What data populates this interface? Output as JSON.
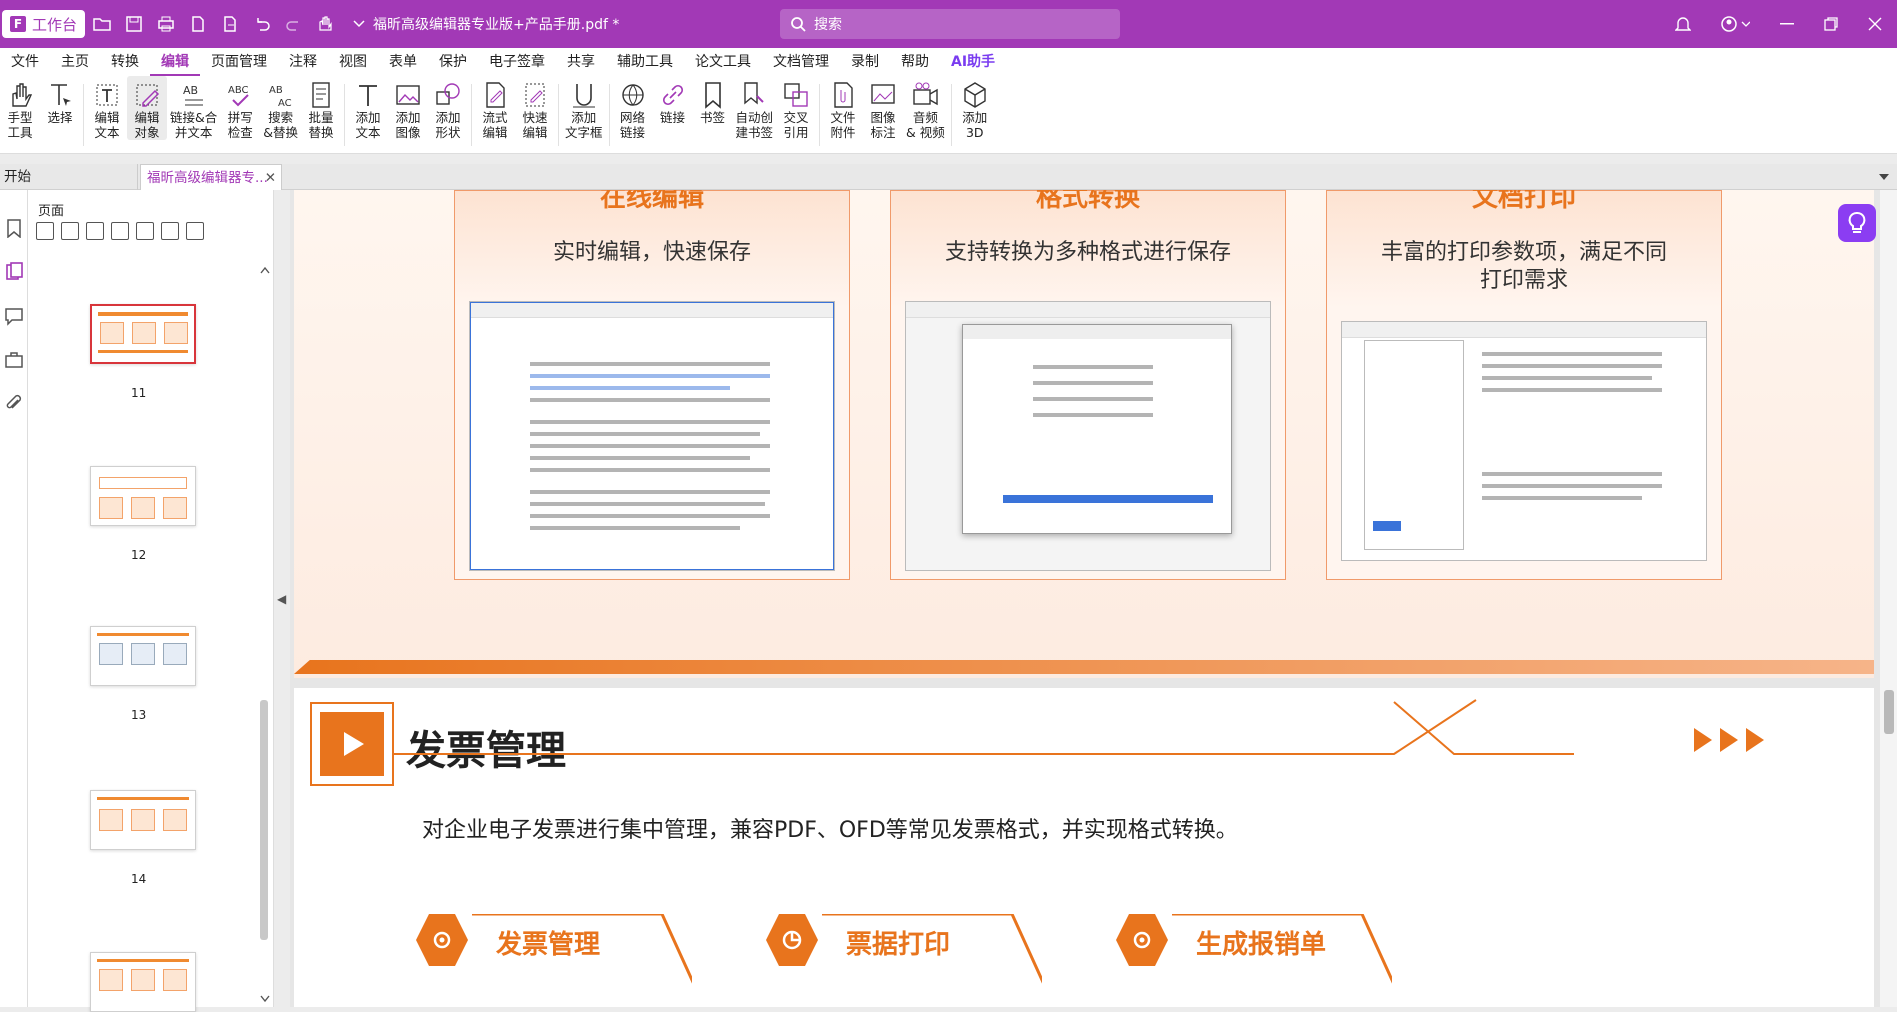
{
  "titlebar": {
    "workbench": "工作台",
    "doc_title": "福昕高级编辑器专业版+产品手册.pdf *",
    "search_placeholder": "搜索"
  },
  "menu": [
    "文件",
    "主页",
    "转换",
    "编辑",
    "页面管理",
    "注释",
    "视图",
    "表单",
    "保护",
    "电子签章",
    "共享",
    "辅助工具",
    "论文工具",
    "文档管理",
    "录制",
    "帮助",
    "AI助手"
  ],
  "menu_active_index": 3,
  "ribbon": [
    {
      "label": "手型\n工具",
      "icon": "hand-icon"
    },
    {
      "label": "选择",
      "icon": "select-icon"
    },
    {
      "label": "编辑\n文本",
      "icon": "edit-text-icon"
    },
    {
      "label": "编辑\n对象",
      "icon": "edit-object-icon",
      "selected": true
    },
    {
      "label": "链接&合\n并文本",
      "icon": "link-merge-text-icon"
    },
    {
      "label": "拼写\n检查",
      "icon": "spellcheck-icon"
    },
    {
      "label": "搜索\n&替换",
      "icon": "search-replace-icon"
    },
    {
      "label": "批量\n替换",
      "icon": "batch-replace-icon"
    },
    {
      "label": "添加\n文本",
      "icon": "add-text-icon"
    },
    {
      "label": "添加\n图像",
      "icon": "add-image-icon"
    },
    {
      "label": "添加\n形状",
      "icon": "add-shape-icon"
    },
    {
      "label": "流式\n编辑",
      "icon": "flow-edit-icon"
    },
    {
      "label": "快速\n编辑",
      "icon": "quick-edit-icon"
    },
    {
      "label": "添加\n文字框",
      "icon": "add-textbox-icon"
    },
    {
      "label": "网络\n链接",
      "icon": "web-link-icon"
    },
    {
      "label": "链接",
      "icon": "link-icon"
    },
    {
      "label": "书签",
      "icon": "bookmark-icon"
    },
    {
      "label": "自动创\n建书签",
      "icon": "auto-bookmark-icon"
    },
    {
      "label": "交叉\n引用",
      "icon": "cross-reference-icon"
    },
    {
      "label": "文件\n附件",
      "icon": "file-attachment-icon"
    },
    {
      "label": "图像\n标注",
      "icon": "image-annotation-icon"
    },
    {
      "label": "音频\n& 视频",
      "icon": "audio-video-icon"
    },
    {
      "label": "添加\n3D",
      "icon": "add-3d-icon"
    }
  ],
  "tabs": {
    "start": "开始",
    "doc": "福昕高级编辑器专..."
  },
  "thumbnails": {
    "title": "页面",
    "pages": [
      "11",
      "12",
      "13",
      "14"
    ]
  },
  "page1": {
    "cards": [
      {
        "heading": "在线编辑",
        "caption": "实时编辑，快速保存"
      },
      {
        "heading": "格式转换",
        "caption": "支持转换为多种格式进行保存"
      },
      {
        "heading": "文档打印",
        "caption": "丰富的打印参数项，满足不同\n打印需求"
      }
    ]
  },
  "page2": {
    "title": "发票管理",
    "desc": "对企业电子发票进行集中管理，兼容PDF、OFD等常见发票格式，并实现格式转换。",
    "features": [
      "发票管理",
      "票据打印",
      "生成报销单"
    ]
  },
  "colors": {
    "brand": "#a239b6",
    "accent": "#e8741d"
  }
}
